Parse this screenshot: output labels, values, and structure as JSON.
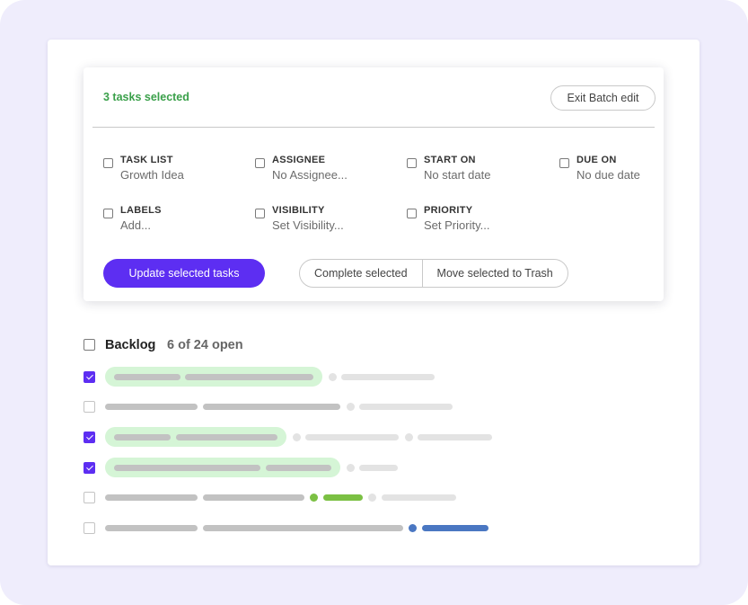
{
  "batch_panel": {
    "selected_count_text": "3 tasks selected",
    "exit_button": "Exit Batch edit",
    "fields": [
      {
        "label": "TASK LIST",
        "value": "Growth Idea"
      },
      {
        "label": "ASSIGNEE",
        "value": "No Assignee..."
      },
      {
        "label": "START ON",
        "value": "No start date"
      },
      {
        "label": "DUE ON",
        "value": "No due date"
      },
      {
        "label": "LABELS",
        "value": "Add..."
      },
      {
        "label": "VISIBILITY",
        "value": "Set Visibility..."
      },
      {
        "label": "PRIORITY",
        "value": "Set Priority..."
      }
    ],
    "update_button": "Update selected tasks",
    "complete_button": "Complete selected",
    "trash_button": "Move selected to Trash"
  },
  "backlog": {
    "title": "Backlog",
    "count_text": "6 of 24 open",
    "tasks": [
      {
        "checked": true,
        "selected": true
      },
      {
        "checked": false,
        "selected": false
      },
      {
        "checked": true,
        "selected": true
      },
      {
        "checked": true,
        "selected": true
      },
      {
        "checked": false,
        "selected": false,
        "tag_color": "green"
      },
      {
        "checked": false,
        "selected": false,
        "tag_color": "blue"
      }
    ]
  },
  "colors": {
    "accent": "#5d2ef2",
    "selected_text": "#3aa04a",
    "selected_row_highlight": "#d5f5d6",
    "tag_green": "#7bc043",
    "tag_blue": "#4a77c2",
    "background": "#efedfc"
  }
}
